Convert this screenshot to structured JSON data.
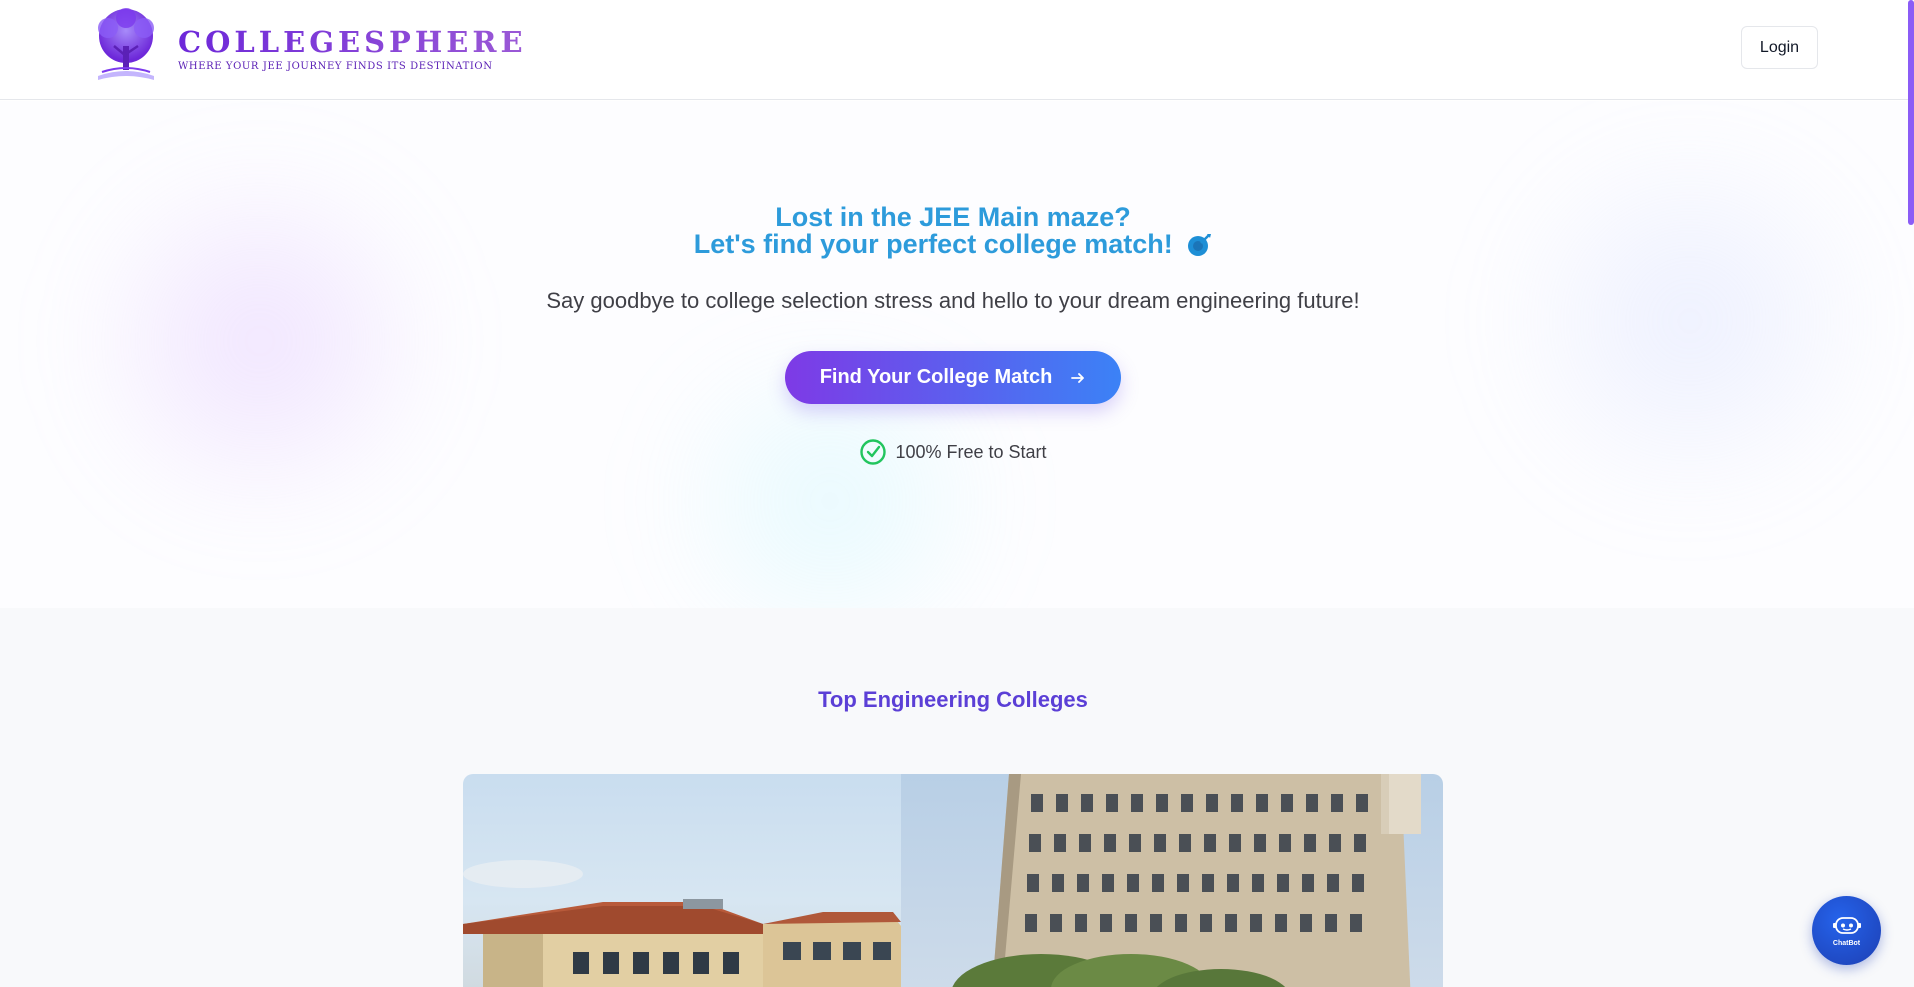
{
  "header": {
    "brand": "COLLEGESPHERE",
    "tagline": "WHERE YOUR JEE JOURNEY FINDS ITS DESTINATION",
    "login_label": "Login"
  },
  "hero": {
    "headline_line1": "Lost in the JEE Main maze?",
    "headline_line2": "Let's find your perfect college match!",
    "subheadline": "Say goodbye to college selection stress and hello to your dream engineering future!",
    "cta_label": "Find Your College Match",
    "free_note": "100% Free to Start"
  },
  "colleges": {
    "section_title": "Top Engineering Colleges"
  },
  "chatbot": {
    "label": "ChatBot"
  },
  "colors": {
    "brand_purple": "#7c3aed",
    "headline_blue": "#2d9bdb",
    "cta_gradient_start": "#7e3ae6",
    "cta_gradient_end": "#3b82f6",
    "section_title": "#5b3fd6",
    "check_green": "#22c55e",
    "chatbot_blue": "#1d4ed8"
  }
}
